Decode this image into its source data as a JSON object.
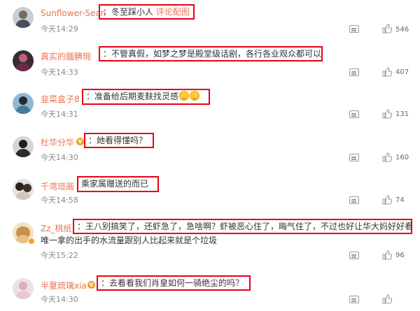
{
  "colors": {
    "accent_name": "#eb7350",
    "highlight_box": "#e60012",
    "meta_text": "#888888"
  },
  "comments": [
    {
      "name": "Sunflower-Sean",
      "text": "：冬至踩小人",
      "link": "评论配图",
      "time": "今天14:29",
      "likes": "546",
      "avatar": "sunflower-avatar"
    },
    {
      "name": "真实的腼腆琬",
      "text": "：不管真假，如梦之梦是殿堂级话剧，各行各业观众都可以去看",
      "time": "今天14:33",
      "likes": "407",
      "avatar": "dark-avatar"
    },
    {
      "name": "韭菜盒子8",
      "text": "：准备给后期麦麸找灵感",
      "emoji": [
        "smile-emoji",
        "smile-emoji"
      ],
      "time": "今天14:31",
      "likes": "131",
      "avatar": "blue-avatar"
    },
    {
      "name": "杜华分华",
      "text": "：她看得懂吗？",
      "time": "今天14:30",
      "likes": "160",
      "avatar": "girl-avatar"
    },
    {
      "name": "千鸢瑄画",
      "text": "乘家属赠送的而已",
      "time": "今天14:58",
      "likes": "74",
      "avatar": "couple-avatar"
    },
    {
      "name": "Zz_桃纸",
      "text": "：王八别搞笑了，还虾急了，急啥啊？虾被恶心住了，晦气住了，不过也好让华大妈好好看看她",
      "extra": "唯一拿的出手的水流量跟别人比起来就是个垃圾",
      "time": "今天15:22",
      "likes": "96",
      "avatar": "bear-avatar"
    },
    {
      "name": "半夏琉璃xia",
      "text": "：去看看我们肖皇如何一骑绝尘的吗？",
      "time": "今天14:30",
      "likes": "",
      "avatar": "pink-avatar"
    }
  ]
}
